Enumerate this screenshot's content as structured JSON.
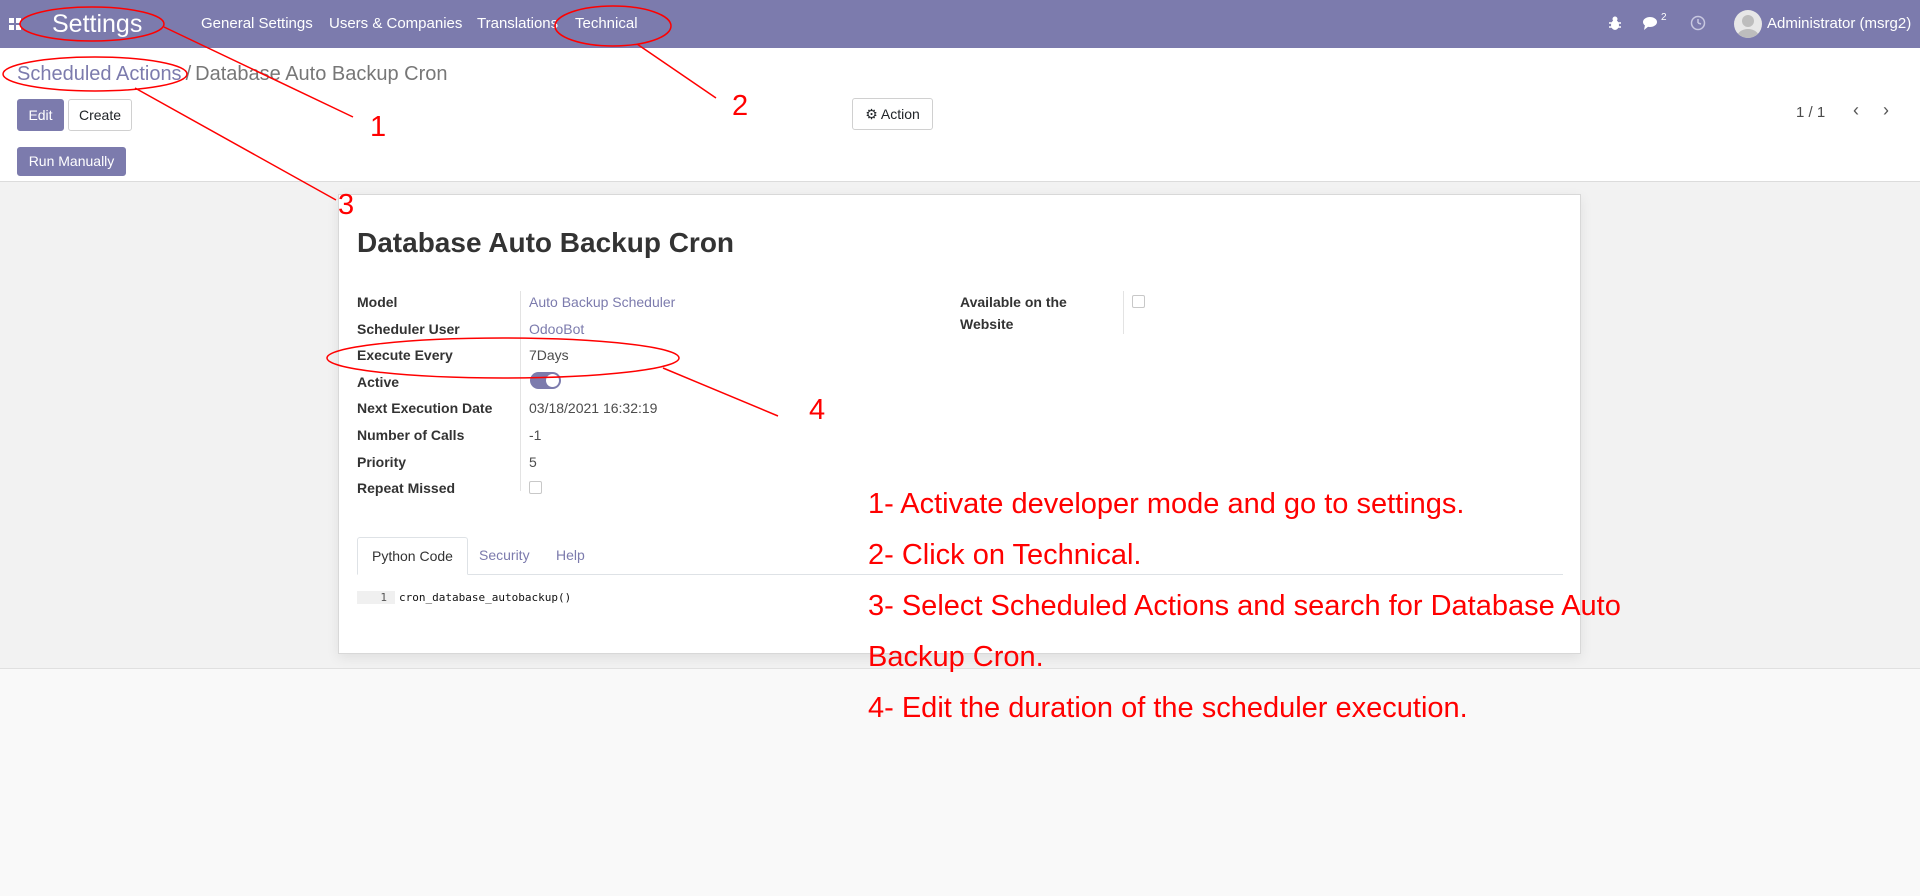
{
  "topbar": {
    "app_title": "Settings",
    "menu": [
      "General Settings",
      "Users & Companies",
      "Translations",
      "Technical"
    ],
    "messages_count": "2",
    "user": "Administrator (msrg2)",
    "bg_color": "#7c7bad"
  },
  "breadcrumb": {
    "parent": "Scheduled Actions",
    "separator": "/",
    "current": "Database Auto Backup Cron"
  },
  "toolbar": {
    "edit_label": "Edit",
    "create_label": "Create",
    "action_label": "Action",
    "pager": "1 / 1"
  },
  "statusbar": {
    "run_manually_label": "Run Manually"
  },
  "record": {
    "title": "Database Auto Backup Cron",
    "fields": {
      "model": {
        "label": "Model",
        "value": "Auto Backup Scheduler"
      },
      "scheduler_user": {
        "label": "Scheduler User",
        "value": "OdooBot"
      },
      "execute_every": {
        "label": "Execute Every",
        "value": "7Days"
      },
      "active": {
        "label": "Active",
        "checked": true
      },
      "next_execution": {
        "label": "Next Execution Date",
        "value": "03/18/2021 16:32:19"
      },
      "number_of_calls": {
        "label": "Number of Calls",
        "value": "-1"
      },
      "priority": {
        "label": "Priority",
        "value": "5"
      },
      "repeat_missed": {
        "label": "Repeat Missed",
        "checked": false
      },
      "website_line1": "Available on the",
      "website_line2": "Website"
    },
    "tabs": [
      "Python Code",
      "Security",
      "Help"
    ],
    "code": {
      "line_number": "1",
      "text": "cron_database_autobackup()"
    }
  },
  "annotations": {
    "numbers": [
      "1",
      "2",
      "3",
      "4"
    ],
    "instructions": [
      "1- Activate developer mode and go to settings.",
      "2- Click on Technical.",
      "3- Select Scheduled Actions and search for Database Auto",
      "Backup Cron.",
      "4- Edit the duration of the scheduler execution."
    ],
    "color": "#ff0000"
  },
  "icons": [
    "apps-icon",
    "bug-icon",
    "chat-icon",
    "clock-icon",
    "avatar",
    "gear-icon",
    "chevron-left-icon",
    "chevron-right-icon"
  ]
}
